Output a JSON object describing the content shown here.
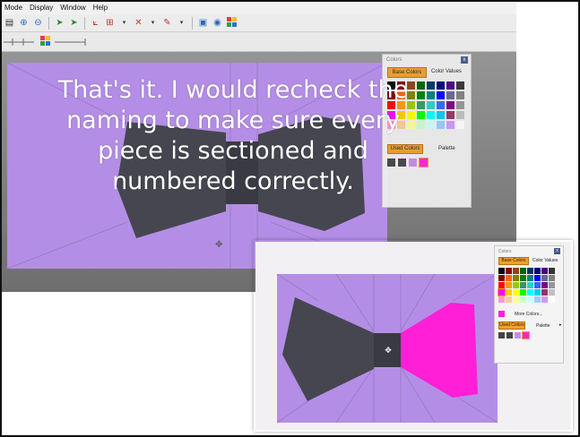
{
  "menu": [
    "Mode",
    "Display",
    "Window",
    "Help"
  ],
  "caption_lines": [
    "That's it. I would recheck the",
    "naming to make sure every",
    "piece is sectioned and",
    "numbered correctly."
  ],
  "main_panel": {
    "title": "Colors",
    "close": "x",
    "tab_base": "Base Colors",
    "tab_values": "Color Values",
    "used_colors": "Used Colors",
    "palette": "Palette"
  },
  "inset_panel": {
    "title": "Colors",
    "close": "x",
    "tab_base": "Base Colors",
    "tab_values": "Color Values",
    "more_colors": "More Colors...",
    "used_colors": "Used Colors",
    "palette": "Palette"
  },
  "colors": {
    "background_lavender": "#b48ee6",
    "bow_gray": "#464650",
    "bow_magenta": "#ff1fd7",
    "accent_orange": "#f0a030"
  },
  "palette_grid": [
    "#000000",
    "#8b0000",
    "#8b4513",
    "#006400",
    "#003366",
    "#000080",
    "#4b0082",
    "#333333",
    "#800000",
    "#ff6600",
    "#808000",
    "#008000",
    "#008080",
    "#0000ff",
    "#666699",
    "#808080",
    "#ff0000",
    "#ff9900",
    "#99cc00",
    "#339966",
    "#33cccc",
    "#3366ff",
    "#800080",
    "#969696",
    "#ff00ff",
    "#ffcc00",
    "#ffff00",
    "#00ff00",
    "#00ffff",
    "#00ccff",
    "#993366",
    "#c0c0c0",
    "#ff99cc",
    "#ffcc99",
    "#ffff99",
    "#ccffcc",
    "#ccffff",
    "#99ccff",
    "#cc99ff",
    "#ffffff"
  ],
  "used_swatches": [
    "#444444",
    "#444444",
    "#c98de8",
    "#ff1fd7"
  ]
}
